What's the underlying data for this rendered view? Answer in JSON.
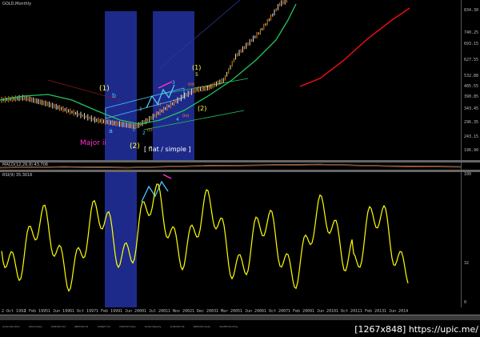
{
  "window": {
    "title": "GOLD,Monthly"
  },
  "colors": {
    "price_up": "#ff8c00",
    "price_down": "#ffffff",
    "ma_green": "#22c55e",
    "ma_red": "#e01010",
    "rsi": "#ffff00",
    "highlight": "#1e2a8a",
    "wave_yellow": "#ffff44",
    "wave_cyan": "#4fc3ff",
    "wave_magenta": "#ff33cc",
    "wave_orange": "#ff8c33"
  },
  "price_scale": [
    "834.30",
    "740.25",
    "693.15",
    "627.55",
    "532.88",
    "485.55",
    "390.85",
    "343.45",
    "296.35",
    "243.15",
    "196.90"
  ],
  "indicator": {
    "title": "MACD(12,26,9) 43.706"
  },
  "rsi": {
    "title": "RSI(9) 35.3016",
    "scale": [
      "100",
      "32",
      "0"
    ]
  },
  "date_labels": [
    "2 Oct 1992",
    "1 Feb 1995",
    "1 Jun 1996",
    "1 Oct 1997",
    "1 Feb 1999",
    "1 Jun 2000",
    "1 Jul 2001",
    "1 Nov 2002",
    "1 Dec 2003",
    "1 Mar 2005",
    "1 Jun 2006",
    "1 Oct 2007",
    "1 Feb 2009",
    "1 Jun 2010",
    "1 Oct 2011",
    "1 Feb 2013",
    "1 Jun 2014"
  ],
  "tabs": [
    "GOLD,Monthly",
    "GOLD,Daily",
    "EURUSD,H4",
    "GBPUSD,H1",
    "USDJPY,H4",
    "USDCHF,Daily",
    "GOLD,Weekly",
    "AUDUSD,H4",
    "NZDUSD,Daily",
    "SILVER,Monthly"
  ],
  "waves": {
    "major_ii": "Major ii",
    "wave_1_top": "(1)",
    "wave_b": "b",
    "wave_a": "a",
    "wave_c": "c",
    "wave_2_bottom": "(2)",
    "flat_simple": "[ flat / simple ]",
    "wave_1_right": "(1)",
    "wave_5": "5",
    "wave_3": "3",
    "wave_1": "1",
    "wave_2": "2",
    "wave_4": "4",
    "wave_2_paren": "(2)",
    "minor_i": "(i)",
    "minor_ii": "(ii)",
    "minor_iii": "(iii)",
    "minor_iv": "(iv)",
    "minor_v": "(v)"
  },
  "watermark": "[1267x848] https://upic.me/"
}
